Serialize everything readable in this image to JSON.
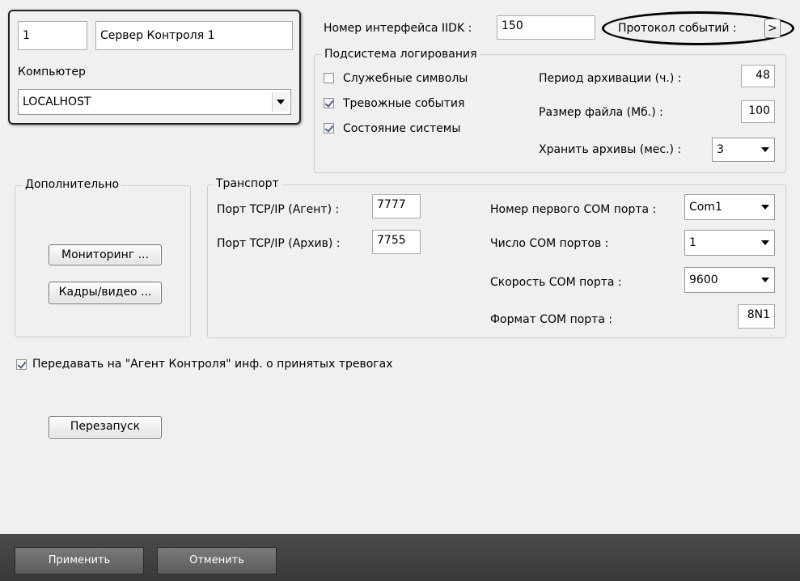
{
  "server": {
    "id_value": "1",
    "name_value": "Сервер Контроля 1",
    "computer_label": "Компьютер",
    "computer_value": "LOCALHOST"
  },
  "iidk": {
    "label": "Номер интерфейса IIDK :",
    "value": "150"
  },
  "protocol": {
    "label": "Протокол событий :",
    "button": ">"
  },
  "logging": {
    "legend": "Подсистема логирования",
    "checkboxes": [
      {
        "label": "Служебные символы",
        "checked": false
      },
      {
        "label": "Тревожные события",
        "checked": true
      },
      {
        "label": "Состояние системы",
        "checked": true
      }
    ],
    "period_label": "Период архивации (ч.) :",
    "period_value": "48",
    "filesize_label": "Размер файла (Мб.) :",
    "filesize_value": "100",
    "keep_label": "Хранить архивы (мес.) :",
    "keep_value": "3"
  },
  "additional": {
    "legend": "Дополнительно",
    "monitoring_button": "Мониторинг ...",
    "frames_button": "Кадры/видео ..."
  },
  "transport": {
    "legend": "Транспорт",
    "tcp_agent_label": "Порт TCP/IP (Агент) :",
    "tcp_agent_value": "7777",
    "tcp_archive_label": "Порт TCP/IP (Архив) :",
    "tcp_archive_value": "7755",
    "com_first_label": "Номер первого COM порта :",
    "com_first_value": "Com1",
    "com_count_label": "Число COM портов :",
    "com_count_value": "1",
    "com_speed_label": "Скорость COM порта :",
    "com_speed_value": "9600",
    "com_format_label": "Формат COM порта :",
    "com_format_value": "8N1"
  },
  "transfer_checkbox": {
    "label": "Передавать на \"Агент Контроля\" инф. о принятых тревогах",
    "checked": true
  },
  "restart_button": "Перезапуск",
  "footer": {
    "apply": "Применить",
    "cancel": "Отменить"
  },
  "colors": {
    "footer_bg": "#444444",
    "annotation_outline": "#000000"
  }
}
